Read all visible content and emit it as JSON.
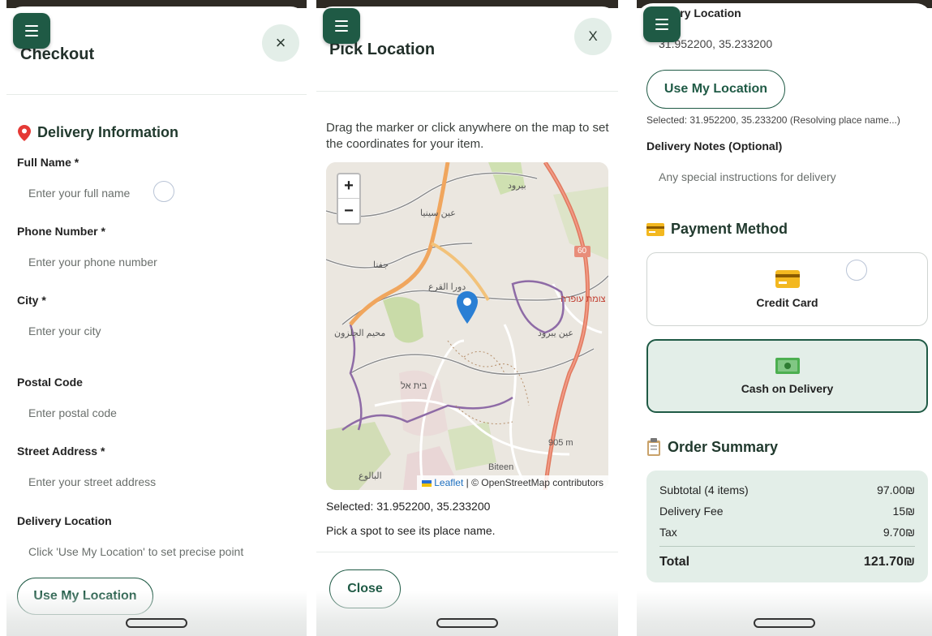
{
  "panel1": {
    "title": "Checkout",
    "close_glyph": "×",
    "section_title": "Delivery Information",
    "section_icon": "pin-icon",
    "fields": [
      {
        "label": "Full Name *",
        "placeholder": "Enter your full name"
      },
      {
        "label": "Phone Number *",
        "placeholder": "Enter your phone number"
      },
      {
        "label": "City *",
        "placeholder": "Enter your city"
      },
      {
        "label": "Postal Code",
        "placeholder": "Enter postal code"
      },
      {
        "label": "Street Address *",
        "placeholder": "Enter your street address"
      },
      {
        "label": "Delivery Location",
        "placeholder": "Click 'Use My Location' to set precise point"
      }
    ],
    "use_location": "Use My Location"
  },
  "panel2": {
    "title": "Pick Location",
    "close_glyph": "X",
    "instructions": "Drag the marker or click anywhere on the map to set the coordinates for your item.",
    "zoom_in": "+",
    "zoom_out": "−",
    "attribution_leaflet": "Leaflet",
    "attribution_rest": " | © OpenStreetMap contributors",
    "map_labels": [
      "بيرود",
      "عين سينيا",
      "دورا القرع",
      "جفنا",
      "60",
      "צומת עופרה",
      "عين يبرود",
      "محيم الجلزون",
      "בית אל",
      "905 m",
      "البالوع",
      "Biteen"
    ],
    "selected": "Selected: 31.952200, 35.233200",
    "place_hint": "Pick a spot to see its place name.",
    "close_button": "Close"
  },
  "panel3": {
    "location_label": "Delivery Location",
    "coords": "31.952200, 35.233200",
    "use_location": "Use My Location",
    "selected_note": "Selected: 31.952200, 35.233200 (Resolving place name...)",
    "notes_label": "Delivery Notes (Optional)",
    "notes_placeholder": "Any special instructions for delivery",
    "payment_title": "Payment Method",
    "payment_icon": "credit-card-icon",
    "payment_options": [
      {
        "label": "Credit Card",
        "icon": "credit-card-icon",
        "selected": false
      },
      {
        "label": "Cash on Delivery",
        "icon": "cash-icon",
        "selected": true
      }
    ],
    "summary_title": "Order Summary",
    "summary_icon": "clipboard-icon",
    "summary": [
      {
        "label": "Subtotal (4 items)",
        "value": "97.00₪"
      },
      {
        "label": "Delivery Fee",
        "value": "15₪"
      },
      {
        "label": "Tax",
        "value": "9.70₪"
      }
    ],
    "total_label": "Total",
    "total_value": "121.70₪"
  },
  "colors": {
    "brand": "#1f5a45",
    "brand_light": "#e3eee8",
    "marker": "#2a7fd4"
  }
}
